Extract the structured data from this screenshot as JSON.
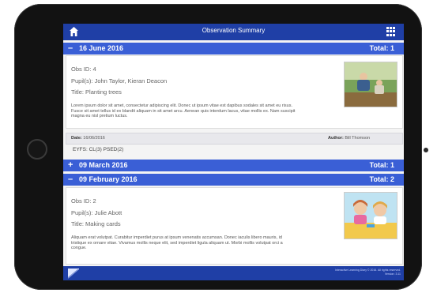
{
  "app": {
    "title": "Observation Summary"
  },
  "sections": [
    {
      "sign": "–",
      "date": "16 June 2016",
      "total": "Total: 1"
    },
    {
      "sign": "+",
      "date": "09 March 2016",
      "total": "Total: 1"
    },
    {
      "sign": "–",
      "date": "09 February 2016",
      "total": "Total: 2"
    }
  ],
  "obs1": {
    "obs_id": "Obs ID: 4",
    "pupils": "Pupil(s): John Taylor, Kieran Deacon",
    "title": "Title: Planting trees",
    "body": "Lorem ipsum dolor sit amet, consectetur adipiscing elit. Donec ut ipsum vitae est dapibus sodales sit amet eu risus. Fusce sit amet tellus id ex blandit aliquam in sit amet arcu. Aenean quis interdum lacus, vitae mollis ex. Nam suscipit magna eu nisl pretium luctus.",
    "date_label": "Date:",
    "date_value": "16/06/2016",
    "author_label": "Author:",
    "author_value": "Bill Thomson",
    "tags": "EYFS: CL(3)  PSED(2)"
  },
  "obs2": {
    "obs_id": "Obs ID: 2",
    "pupils": "Pupil(s): Julie Abott",
    "title": "Title: Making cards",
    "body": "Aliquam erat volutpat. Curabitur imperdiet purus at ipsum venenatis accumsan. Donec iaculis libero mauris, id tristique ex ornare vitae. Vivamus mollis neque elit, sed imperdiet ligula aliquam ut. Morbi mollis volutpat orci a congue."
  },
  "footer": {
    "copyright": "Interactive Learning Diary © 2016. All rights reserved.",
    "version": "Version: 3.11"
  },
  "icons": {
    "home": "home-icon",
    "grid": "grid-menu-icon",
    "logo": "app-logo-icon"
  },
  "colors": {
    "topbar": "#1f3fa6",
    "section_header": "#3a5fd6"
  }
}
